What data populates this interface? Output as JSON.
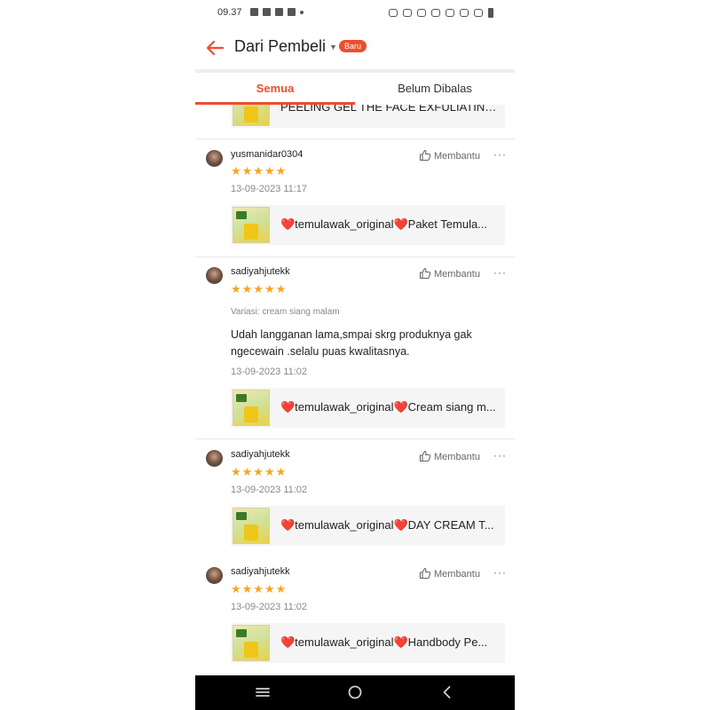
{
  "status_bar": {
    "time": "09.37"
  },
  "header": {
    "title": "Dari Pembeli",
    "badge": "Baru"
  },
  "tabs": [
    {
      "label": "Semua",
      "active": true
    },
    {
      "label": "Belum Dibalas",
      "active": false
    }
  ],
  "top_partial_product": "PEELING GEL THE FACE EXFULIATING...",
  "reviews": [
    {
      "username": "yusmanidar0304",
      "stars": "★★★★★",
      "rating": 5,
      "helpful_label": "Membantu",
      "date": "13-09-2023 11:17",
      "product": "❤️temulawak_original❤️Paket Temula..."
    },
    {
      "username": "sadiyahjutekk",
      "stars": "★★★★★",
      "rating": 5,
      "helpful_label": "Membantu",
      "variation": "Variasi: cream siang malam",
      "comment": "Udah langganan lama,smpai skrg produknya gak ngecewain .selalu puas kwalitasnya.",
      "date": "13-09-2023 11:02",
      "product": "❤️temulawak_original❤️Cream siang m..."
    },
    {
      "username": "sadiyahjutekk",
      "stars": "★★★★★",
      "rating": 5,
      "helpful_label": "Membantu",
      "date": "13-09-2023 11:02",
      "product": "❤️temulawak_original❤️DAY CREAM T..."
    },
    {
      "username": "sadiyahjutekk",
      "stars": "★★★★★",
      "rating": 5,
      "helpful_label": "Membantu",
      "date": "13-09-2023 11:02",
      "product": "❤️temulawak_original❤️Handbody Pe..."
    }
  ],
  "colors": {
    "accent": "#ee4d2d",
    "stars": "#f5a623"
  }
}
